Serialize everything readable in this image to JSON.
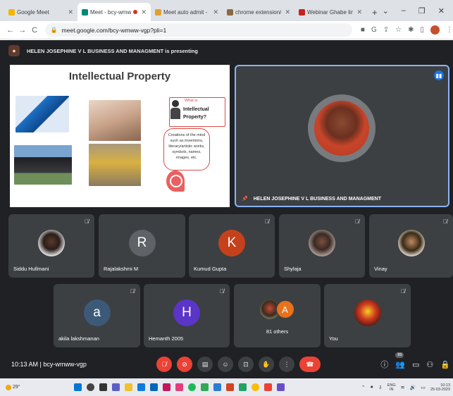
{
  "browser": {
    "tabs": [
      {
        "title": "Google Meet",
        "favicon_color": "#f4b400",
        "active": false
      },
      {
        "title": "Meet - bcy-wmww-v",
        "favicon_color": "#00897b",
        "active": true
      },
      {
        "title": "Meet auto admit - Chron",
        "favicon_color": "#e0a030",
        "active": false
      },
      {
        "title": "chrome extension//appc",
        "favicon_color": "#8a6a40",
        "active": false
      },
      {
        "title": "Webinar Ghabe link - ann",
        "favicon_color": "#c5221f",
        "active": false
      }
    ],
    "new_tab": "+",
    "window_controls": [
      "⌄",
      "–",
      "❐",
      "✕"
    ],
    "url": "meet.google.com/bcy-wmww-vgp?pli=1",
    "nav": [
      "←",
      "→",
      "C"
    ]
  },
  "meet": {
    "presenting_banner": "HELEN JOSEPHINE V L BUSINESS AND MANAGMENT is presenting",
    "slide": {
      "title": "Intellectual Property",
      "question_small": "What is",
      "question_line1": "Intellectual",
      "question_line2": "Property?",
      "definition": "Creations of the mind such as inventions, literary/artistic works, symbols, names, images, etc."
    },
    "speaker": {
      "name": "HELEN JOSEPHINE V L BUSINESS AND MANAGMENT"
    },
    "participants_row1": [
      {
        "name": "Siddu Hullmani",
        "initial": "",
        "avatar_color": "",
        "photo": "photo-a"
      },
      {
        "name": "Rajalakshmi M",
        "initial": "R",
        "avatar_color": "#5f6368",
        "photo": ""
      },
      {
        "name": "Kumud Gupta",
        "initial": "K",
        "avatar_color": "#c5411c",
        "photo": ""
      },
      {
        "name": "Shylaja",
        "initial": "",
        "avatar_color": "",
        "photo": "photo-b"
      },
      {
        "name": "Vinay",
        "initial": "",
        "avatar_color": "",
        "photo": "photo-c"
      }
    ],
    "participants_row2": [
      {
        "name": "akila lakshmanan",
        "initial": "a",
        "avatar_color": "#3c5a78"
      },
      {
        "name": "Hemanth 2005",
        "initial": "H",
        "avatar_color": "#5b35c8"
      }
    ],
    "others": {
      "label": "81 others",
      "initial": "A"
    },
    "self": {
      "name": "You"
    },
    "meeting_info": "10:13 AM  |  bcy-wmww-vgp",
    "participant_count_badge": "89"
  },
  "taskbar": {
    "weather": "29°",
    "lang_line1": "ENG",
    "lang_line2": "IN",
    "time": "10:13",
    "date": "25-03-2023"
  }
}
